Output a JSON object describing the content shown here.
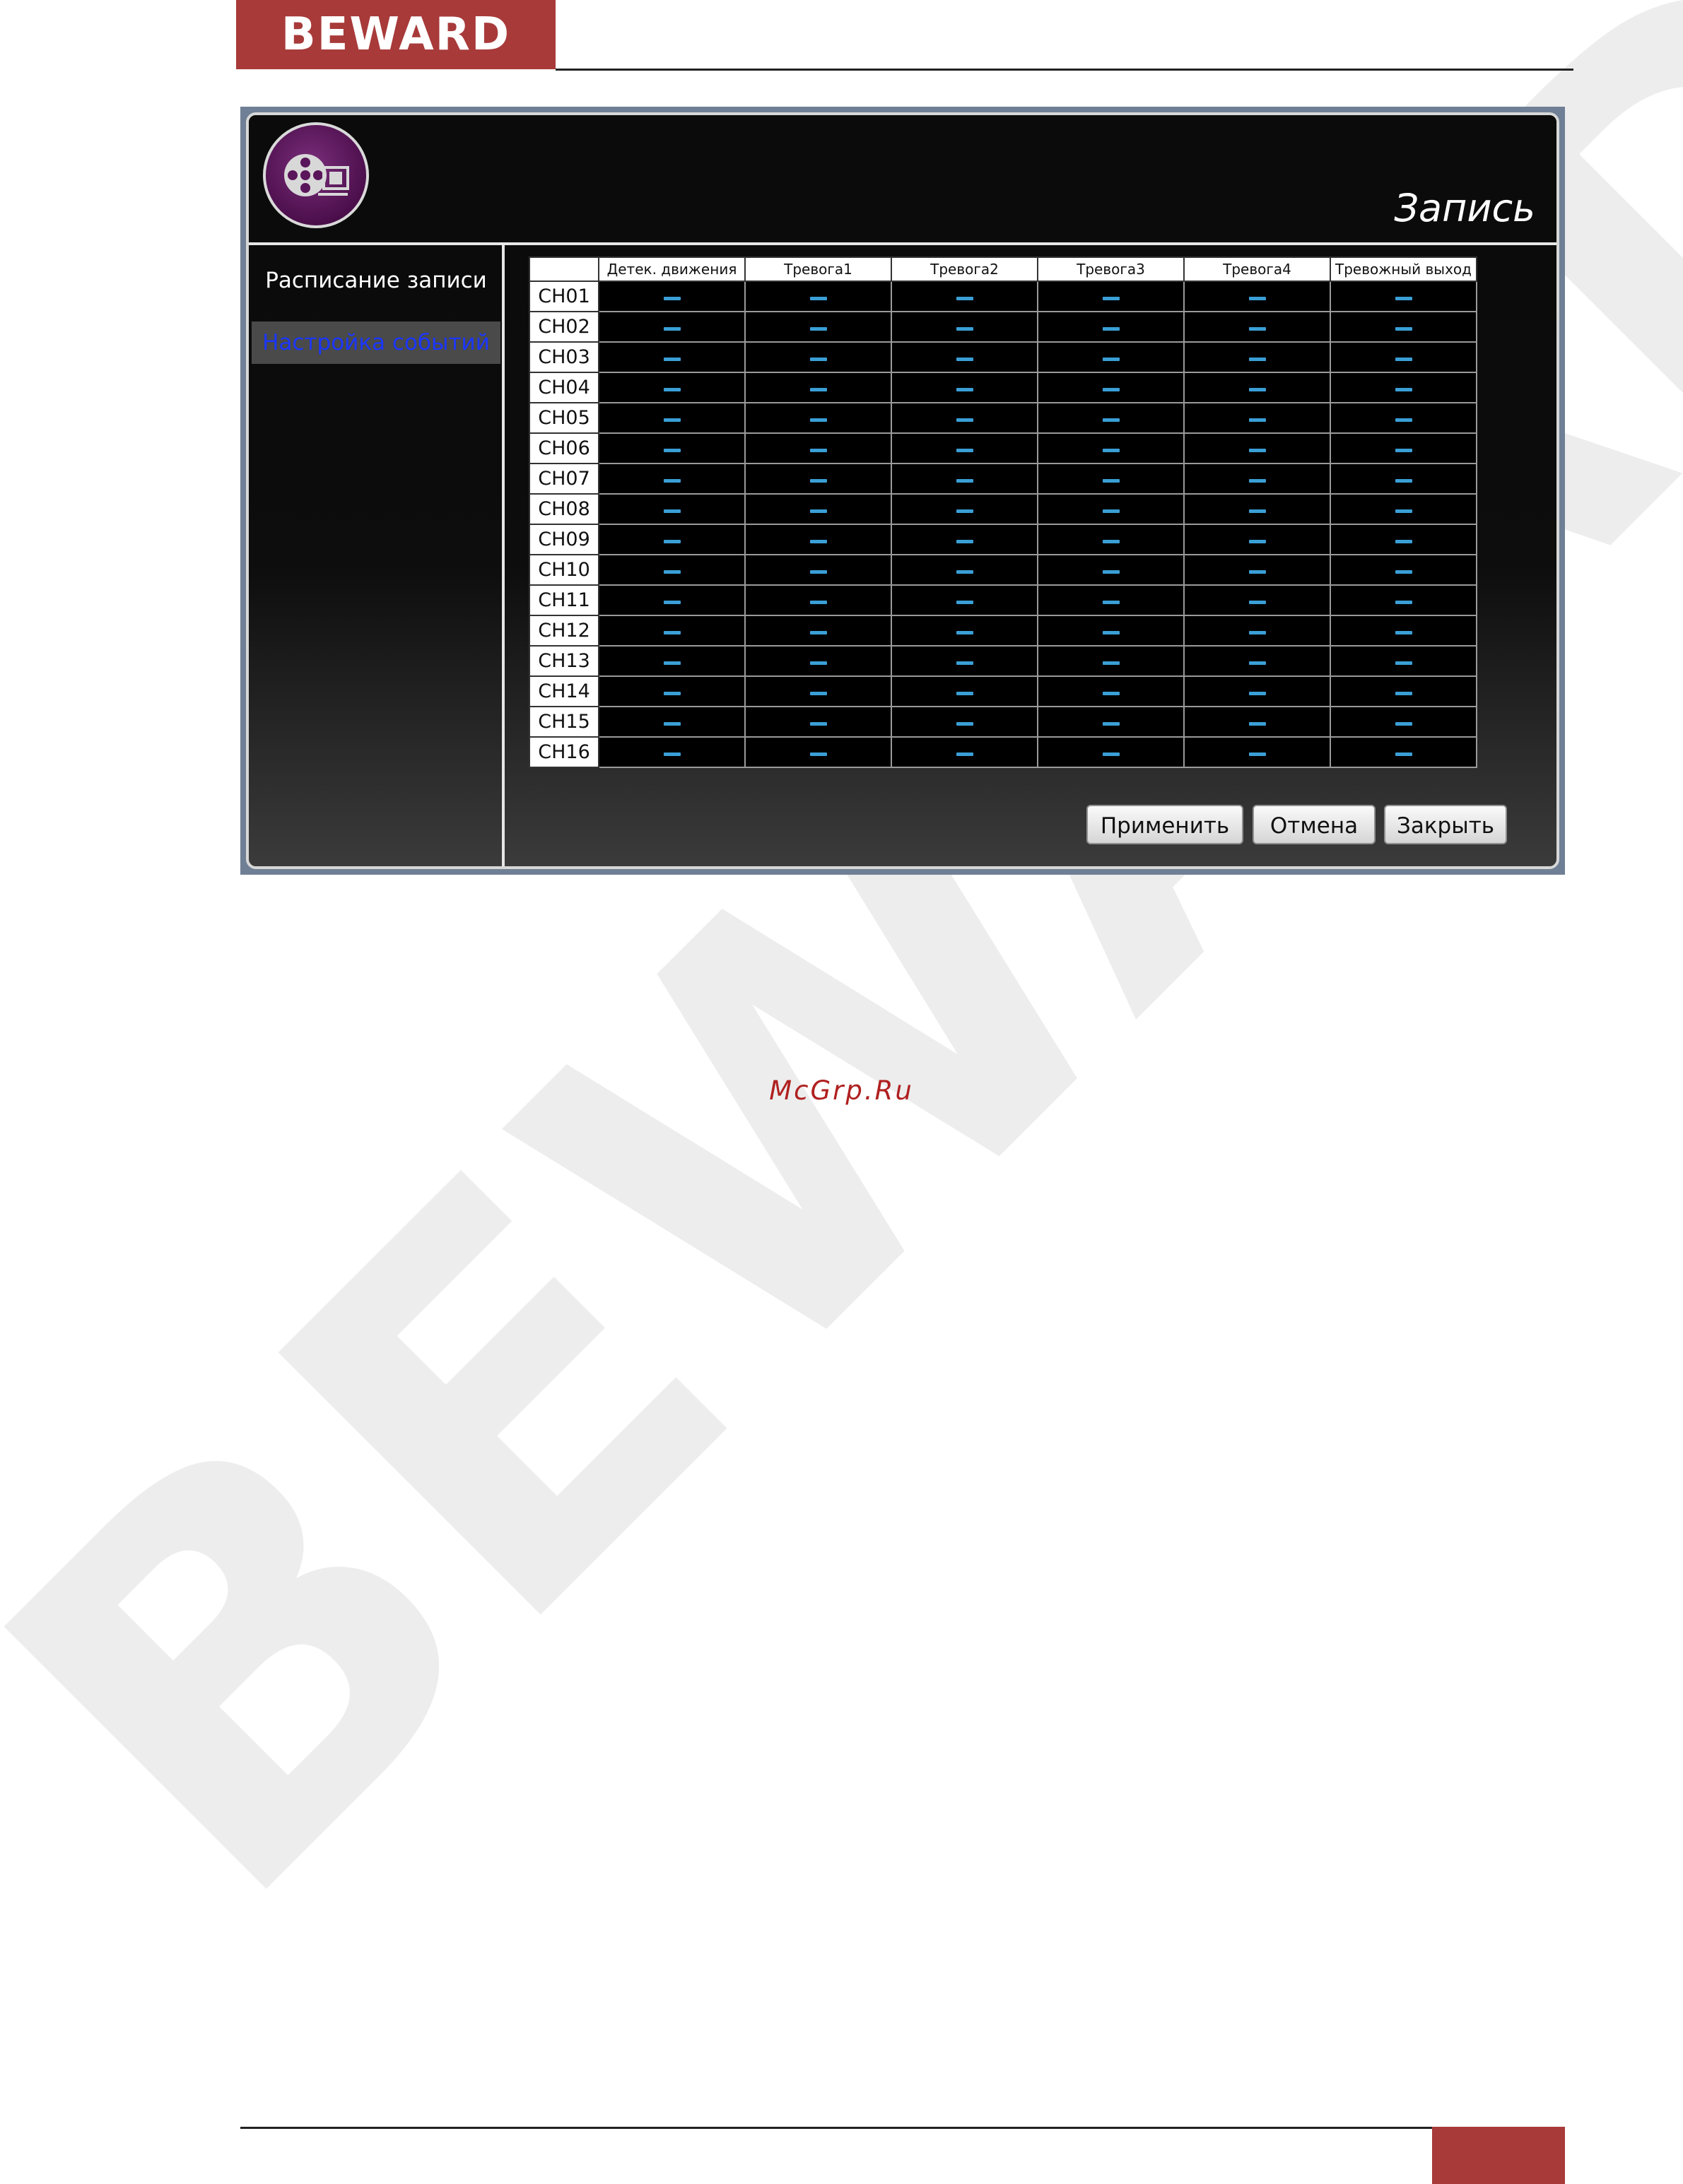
{
  "brand": {
    "logo_text": "BEWARD",
    "accent": "#a83a3a"
  },
  "watermark": {
    "text": "McGrp.Ru",
    "big_logo_text": "BEWARD"
  },
  "window": {
    "title": "Запись",
    "icon": "film-reel-icon",
    "sidebar": {
      "items": [
        {
          "label": "Расписание записи",
          "active": false
        },
        {
          "label": "Настройка событий",
          "active": true
        }
      ]
    },
    "table": {
      "columns": [
        "Детек. движения",
        "Тревога1",
        "Тревога2",
        "Тревога3",
        "Тревога4",
        "Тревожный выход"
      ],
      "rows": [
        {
          "channel": "CH01",
          "cells": [
            "—",
            "—",
            "—",
            "—",
            "—",
            "—"
          ]
        },
        {
          "channel": "CH02",
          "cells": [
            "—",
            "—",
            "—",
            "—",
            "—",
            "—"
          ]
        },
        {
          "channel": "CH03",
          "cells": [
            "—",
            "—",
            "—",
            "—",
            "—",
            "—"
          ]
        },
        {
          "channel": "CH04",
          "cells": [
            "—",
            "—",
            "—",
            "—",
            "—",
            "—"
          ]
        },
        {
          "channel": "CH05",
          "cells": [
            "—",
            "—",
            "—",
            "—",
            "—",
            "—"
          ]
        },
        {
          "channel": "CH06",
          "cells": [
            "—",
            "—",
            "—",
            "—",
            "—",
            "—"
          ]
        },
        {
          "channel": "CH07",
          "cells": [
            "—",
            "—",
            "—",
            "—",
            "—",
            "—"
          ]
        },
        {
          "channel": "CH08",
          "cells": [
            "—",
            "—",
            "—",
            "—",
            "—",
            "—"
          ]
        },
        {
          "channel": "CH09",
          "cells": [
            "—",
            "—",
            "—",
            "—",
            "—",
            "—"
          ]
        },
        {
          "channel": "CH10",
          "cells": [
            "—",
            "—",
            "—",
            "—",
            "—",
            "—"
          ]
        },
        {
          "channel": "CH11",
          "cells": [
            "—",
            "—",
            "—",
            "—",
            "—",
            "—"
          ]
        },
        {
          "channel": "CH12",
          "cells": [
            "—",
            "—",
            "—",
            "—",
            "—",
            "—"
          ]
        },
        {
          "channel": "CH13",
          "cells": [
            "—",
            "—",
            "—",
            "—",
            "—",
            "—"
          ]
        },
        {
          "channel": "CH14",
          "cells": [
            "—",
            "—",
            "—",
            "—",
            "—",
            "—"
          ]
        },
        {
          "channel": "CH15",
          "cells": [
            "—",
            "—",
            "—",
            "—",
            "—",
            "—"
          ]
        },
        {
          "channel": "CH16",
          "cells": [
            "—",
            "—",
            "—",
            "—",
            "—",
            "—"
          ]
        }
      ],
      "cell_color": "#3a9fd6"
    },
    "buttons": {
      "apply": "Применить",
      "cancel": "Отмена",
      "close": "Закрыть"
    }
  }
}
